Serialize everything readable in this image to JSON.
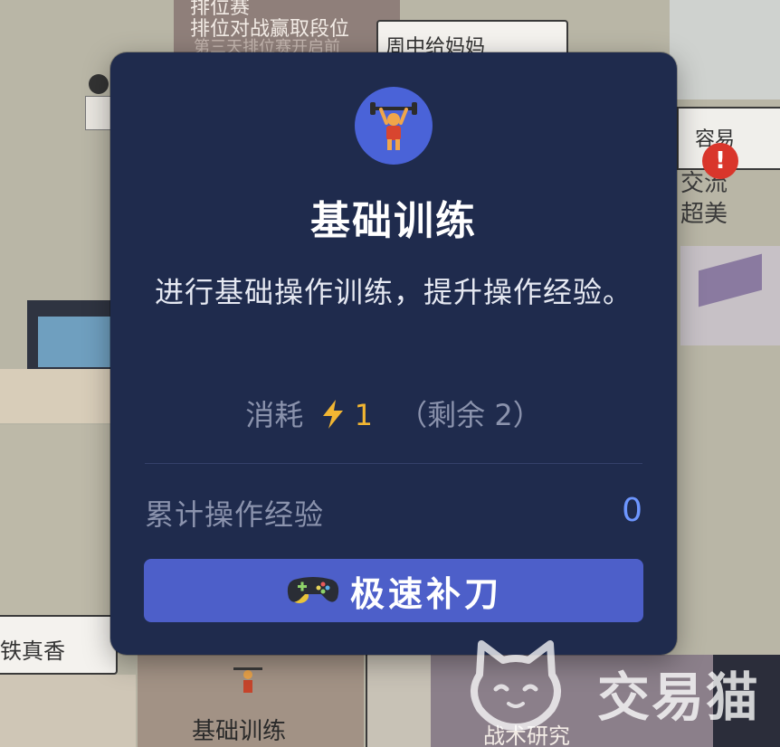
{
  "background": {
    "top_card_line1": "排位赛",
    "top_card_line2": "排位对战赢取段位",
    "top_card_line3": "第三天排位赛开启前",
    "top_bubble": "周中给妈妈",
    "right_panel": "容易",
    "right_text_line1": "交流",
    "right_text_line2": "超美",
    "bottom_left_bubble": "铁真香",
    "bottom_card_label": "基础训练",
    "bottom_card2_label": "战术研究"
  },
  "modal": {
    "icon": "weightlifter-icon",
    "title": "基础训练",
    "description": "进行基础操作训练，提升操作经验。",
    "cost": {
      "label": "消耗",
      "energy_icon": "lightning-icon",
      "amount": "1",
      "remaining": "（剩余 2）"
    },
    "stat": {
      "label": "累计操作经验",
      "value": "0"
    },
    "action_button": {
      "icon": "gamepad-icon",
      "label": "极速补刀"
    }
  },
  "watermark": {
    "logo": "cat-logo",
    "text": "交易猫"
  },
  "colors": {
    "modal_bg": "#1f2b4d",
    "accent_blue": "#4d5fc9",
    "value_blue": "#6d96ff",
    "energy_yellow": "#f2b632",
    "muted_text": "#8b93ad"
  }
}
